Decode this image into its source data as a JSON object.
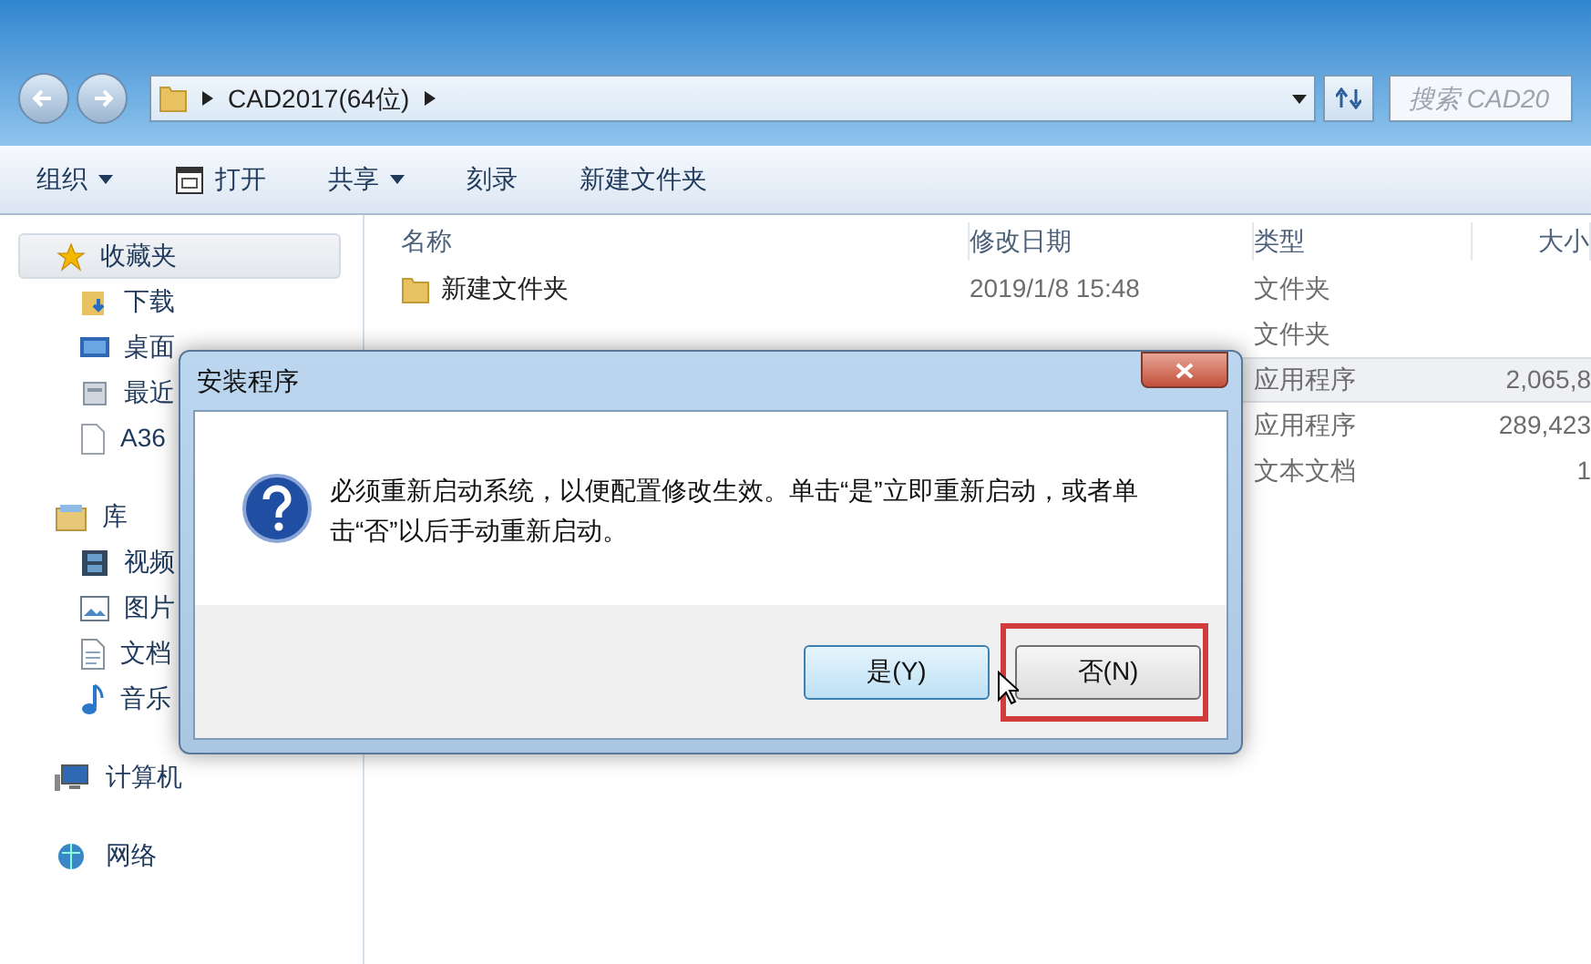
{
  "address_bar": {
    "path": [
      "CAD2017(64位)"
    ],
    "search_placeholder": "搜索 CAD20"
  },
  "toolbar": [
    {
      "label": "组织",
      "kind": "menu",
      "dropdown": true
    },
    {
      "label": "打开",
      "kind": "open",
      "dropdown": false
    },
    {
      "label": "共享",
      "kind": "menu",
      "dropdown": true
    },
    {
      "label": "刻录",
      "kind": "text",
      "dropdown": false
    },
    {
      "label": "新建文件夹",
      "kind": "text",
      "dropdown": false
    }
  ],
  "sidebar": {
    "groups": [
      {
        "label": "收藏夹",
        "kind": "favorites",
        "selected": true,
        "items": [
          {
            "label": "下载",
            "kind": "downloads"
          },
          {
            "label": "桌面",
            "kind": "desktop"
          },
          {
            "label": "最近",
            "kind": "recent"
          },
          {
            "label": "A36",
            "kind": "file"
          }
        ]
      },
      {
        "label": "库",
        "kind": "library",
        "selected": false,
        "items": [
          {
            "label": "视频",
            "kind": "video"
          },
          {
            "label": "图片",
            "kind": "picture"
          },
          {
            "label": "文档",
            "kind": "document"
          },
          {
            "label": "音乐",
            "kind": "music"
          }
        ]
      },
      {
        "label": "计算机",
        "kind": "computer",
        "selected": false
      },
      {
        "label": "网络",
        "kind": "network",
        "selected": false
      }
    ]
  },
  "table": {
    "columns": [
      "名称",
      "修改日期",
      "类型",
      "大小"
    ],
    "rows": [
      {
        "name": "新建文件夹",
        "date": "2019/1/8 15:48",
        "type": "文件夹",
        "selected": false
      },
      {
        "type": "文件夹",
        "selected": false
      },
      {
        "type": "应用程序",
        "size": "2,065,8",
        "selected": true
      },
      {
        "type": "应用程序",
        "size": "289,423",
        "selected": false
      },
      {
        "type": "文本文档",
        "size": "1",
        "selected": false
      }
    ]
  },
  "dialog": {
    "title": "安装程序",
    "message": "必须重新启动系统，以便配置修改生效。单击“是”立即重新启动，或者单击“否”以后手动重新启动。",
    "buttons": [
      {
        "label": "是(Y)",
        "focused": true,
        "annotated": false
      },
      {
        "label": "否(N)",
        "focused": false,
        "annotated": true
      }
    ]
  }
}
